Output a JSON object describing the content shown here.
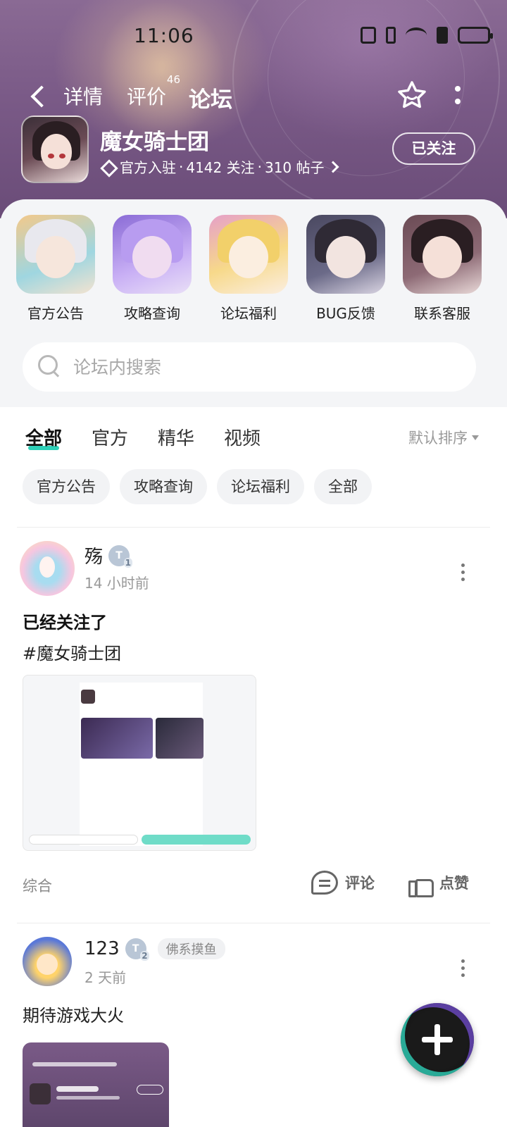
{
  "status_bar": {
    "time": "11:06"
  },
  "nav": {
    "tabs": [
      {
        "label": "详情"
      },
      {
        "label": "评价",
        "badge": "46"
      },
      {
        "label": "论坛"
      }
    ]
  },
  "game": {
    "name": "魔女骑士团",
    "meta": {
      "official": "官方入驻",
      "sep": "·",
      "followers": "4142 关注",
      "posts": "310 帖子"
    },
    "follow_label": "已关注"
  },
  "quick_links": [
    {
      "label": "官方公告",
      "colors": [
        "#f3c98a",
        "#e8e8ee",
        "#f6e6dc"
      ]
    },
    {
      "label": "攻略查询",
      "colors": [
        "#8a6bd6",
        "#b89cf0",
        "#f0dcf0"
      ]
    },
    {
      "label": "论坛福利",
      "colors": [
        "#f7d98a",
        "#f2d06a",
        "#fbeee0"
      ]
    },
    {
      "label": "BUG反馈",
      "colors": [
        "#4a4860",
        "#2f2a35",
        "#f2e4e0"
      ]
    },
    {
      "label": "联系客服",
      "colors": [
        "#6b4b55",
        "#2a1e22",
        "#f5e0d8"
      ]
    }
  ],
  "search": {
    "placeholder": "论坛内搜索"
  },
  "filter_tabs": [
    "全部",
    "官方",
    "精华",
    "视频"
  ],
  "sort_label": "默认排序",
  "chips": [
    "官方公告",
    "攻略查询",
    "论坛福利",
    "全部"
  ],
  "posts": [
    {
      "author": "殇",
      "level": "T",
      "level_num": "1",
      "time": "14 小时前",
      "title": "已经关注了",
      "text": "#魔女骑士团",
      "category": "综合",
      "comment_label": "评论",
      "like_label": "点赞"
    },
    {
      "author": "123",
      "level": "T",
      "level_num": "2",
      "tag": "佛系摸鱼",
      "time": "2 天前",
      "text": "期待游戏大火"
    }
  ],
  "colors": {
    "accent": "#2ed0b8",
    "header_bg": "#7a5a87"
  }
}
